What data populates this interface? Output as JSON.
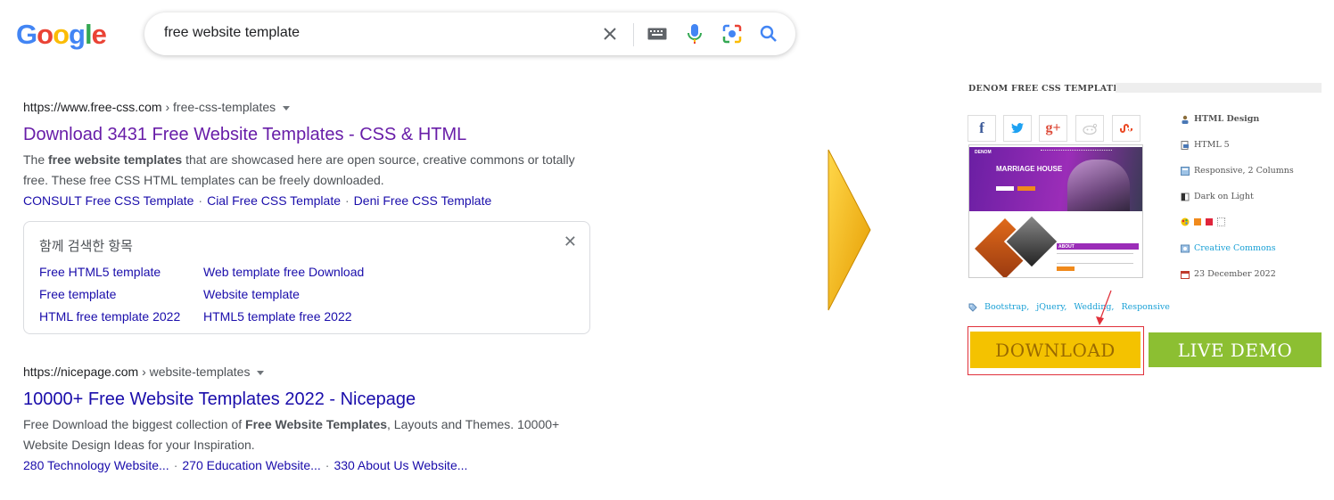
{
  "google": {
    "logo_letters": [
      "G",
      "o",
      "o",
      "g",
      "l",
      "e"
    ],
    "logo_colors": [
      "#4285f4",
      "#ea4335",
      "#fbbc05",
      "#4285f4",
      "#34a853",
      "#ea4335"
    ],
    "query": "free website template",
    "icons": [
      "close-icon",
      "keyboard-icon",
      "microphone-icon",
      "camera-lens-icon",
      "search-icon"
    ]
  },
  "results": [
    {
      "cite_domain": "https://www.free-css.com",
      "cite_path": " › free-css-templates",
      "title": "Download 3431 Free Website Templates - CSS & HTML",
      "snippet_parts": [
        "The ",
        "free website templates",
        " that are showcased here are open source, creative commons or totally free. These free CSS HTML templates can be freely downloaded."
      ],
      "sitelinks": [
        "CONSULT Free CSS Template",
        "Cial Free CSS Template",
        "Deni Free CSS Template"
      ],
      "title_color": "#681da8"
    },
    {
      "cite_domain": "https://nicepage.com",
      "cite_path": " › website-templates",
      "title": "10000+ Free Website Templates 2022 - Nicepage",
      "snippet_parts": [
        "Free Download the biggest collection of ",
        "Free Website Templates",
        ", Layouts and Themes. 10000+ Website Design Ideas for your Inspiration."
      ],
      "sitelinks": [
        "280 Technology Website...",
        "270 Education Website...",
        "330 About Us Website..."
      ],
      "title_color": "#1a0dab"
    }
  ],
  "related": {
    "heading": "함께 검색한 항목",
    "items": [
      "Free HTML5 template",
      "Web template free Download",
      "Free template",
      "Website template",
      "HTML free template 2022",
      "HTML5 template free 2022"
    ]
  },
  "template_panel": {
    "title": "DENOM FREE CSS TEMPLATE",
    "share_icons": [
      {
        "name": "facebook-icon",
        "glyph": "f",
        "color": "#3b5998"
      },
      {
        "name": "twitter-icon",
        "glyph": "t",
        "color": "#1da1f2"
      },
      {
        "name": "google-plus-icon",
        "glyph": "g+",
        "color": "#dd4b39"
      },
      {
        "name": "reddit-icon",
        "glyph": "◕",
        "color": "#cccccc"
      },
      {
        "name": "stumbleupon-icon",
        "glyph": "su",
        "color": "#eb4924"
      }
    ],
    "preview": {
      "brand": "DENOM",
      "hero_heading": "MARRIAGE HOUSE",
      "about_label": "ABOUT"
    },
    "meta": [
      {
        "icon": "designer-icon",
        "text": "HTML Design",
        "bold": true
      },
      {
        "icon": "html-file-icon",
        "text": "HTML 5"
      },
      {
        "icon": "layout-icon",
        "text": "Responsive, 2 Columns"
      },
      {
        "icon": "contrast-icon",
        "text": "Dark on Light"
      },
      {
        "icon": "palette-icon",
        "text": "",
        "swatches": [
          "#f08a1c",
          "#e0243b",
          "#ffffff"
        ]
      },
      {
        "icon": "license-icon",
        "text": "Creative Commons",
        "link": true
      },
      {
        "icon": "calendar-icon",
        "text": "23 December 2022"
      }
    ],
    "tags": [
      "Bootstrap,",
      "jQuery,",
      "Wedding,",
      "Responsive"
    ],
    "download_label": "DOWNLOAD",
    "live_demo_label": "LIVE DEMO"
  }
}
